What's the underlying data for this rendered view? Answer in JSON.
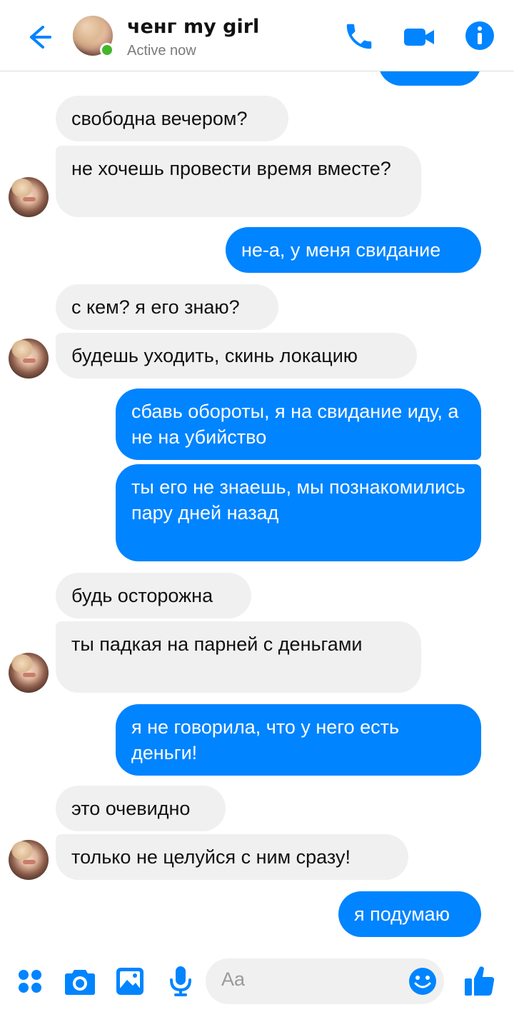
{
  "header": {
    "contact_name": "ченг my girl",
    "status": "Active now"
  },
  "messages": [
    {
      "side": "in",
      "text": "свободна вечером?"
    },
    {
      "side": "in",
      "text": "не хочешь провести время вместе?"
    },
    {
      "side": "out",
      "text": "не-а, у меня свидание"
    },
    {
      "side": "in",
      "text": "с кем? я его знаю?"
    },
    {
      "side": "in",
      "text": "будешь уходить, скинь локацию"
    },
    {
      "side": "out",
      "text": "сбавь обороты, я на свидание иду, а не на убийство"
    },
    {
      "side": "out",
      "text": "ты его не знаешь, мы познакомились пару дней назад"
    },
    {
      "side": "in",
      "text": "будь осторожна"
    },
    {
      "side": "in",
      "text": "ты падкая на парней с деньгами"
    },
    {
      "side": "out",
      "text": "я не говорила, что у него есть деньги!"
    },
    {
      "side": "in",
      "text": "это очевидно"
    },
    {
      "side": "in",
      "text": "только не целуйся с ним сразу!"
    },
    {
      "side": "out",
      "text": "я подумаю"
    }
  ],
  "composer": {
    "placeholder": "Aa"
  },
  "colors": {
    "accent": "#0084ff",
    "incoming_bubble": "#f1f0f0",
    "online": "#42b72a"
  }
}
